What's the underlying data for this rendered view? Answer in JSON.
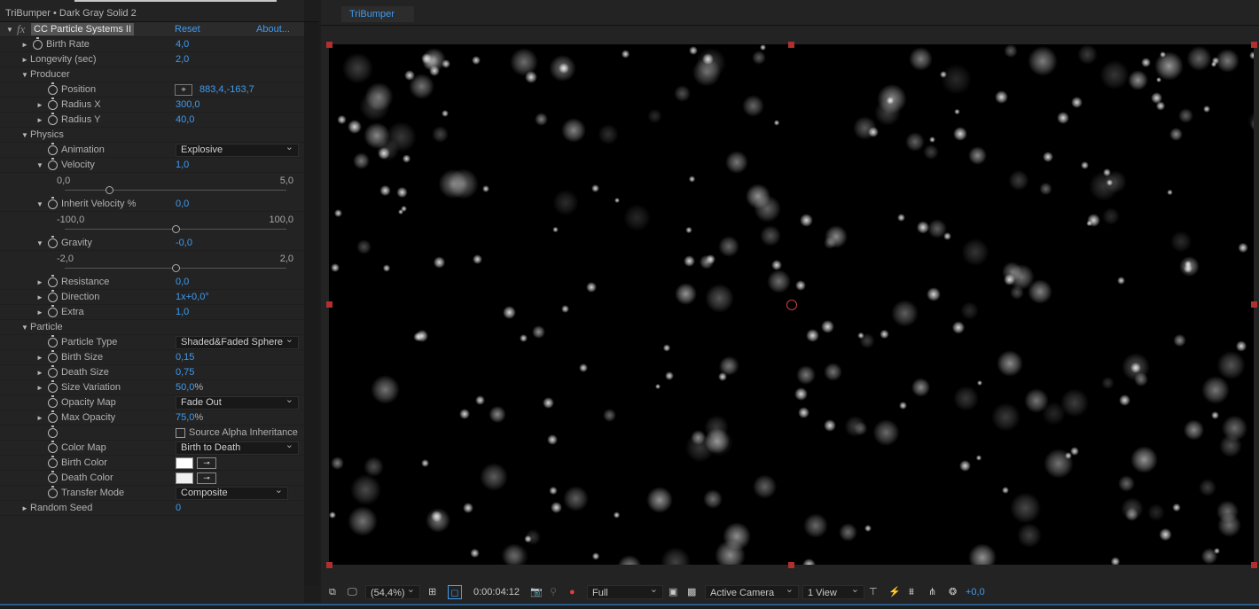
{
  "panel": {
    "title": "TriBumper • Dark Gray Solid 2",
    "effect_name": "CC Particle Systems II",
    "reset": "Reset",
    "about": "About..."
  },
  "rows": [
    {
      "kind": "prop",
      "indent": 1,
      "twirl": "closed",
      "stopwatch": true,
      "label": "Birth Rate",
      "value": "4,0"
    },
    {
      "kind": "prop",
      "indent": 1,
      "twirl": "closed",
      "stopwatch": false,
      "label": "Longevity (sec)",
      "value": "2,0"
    },
    {
      "kind": "group",
      "twirl": "open",
      "label": "Producer"
    },
    {
      "kind": "prop",
      "indent": 2,
      "twirl": "none",
      "stopwatch": true,
      "label": "Position",
      "value": "883,4,-163,7",
      "point": true
    },
    {
      "kind": "prop",
      "indent": 2,
      "twirl": "closed",
      "stopwatch": true,
      "label": "Radius X",
      "value": "300,0"
    },
    {
      "kind": "prop",
      "indent": 2,
      "twirl": "closed",
      "stopwatch": true,
      "label": "Radius Y",
      "value": "40,0"
    },
    {
      "kind": "group",
      "twirl": "open",
      "label": "Physics"
    },
    {
      "kind": "dropdown",
      "indent": 2,
      "twirl": "none",
      "stopwatch": true,
      "label": "Animation",
      "value": "Explosive"
    },
    {
      "kind": "prop",
      "indent": 2,
      "twirl": "open",
      "stopwatch": true,
      "label": "Velocity",
      "value": "1,0"
    },
    {
      "kind": "slider",
      "min": "0,0",
      "max": "5,0",
      "fraction": 0.2
    },
    {
      "kind": "prop",
      "indent": 2,
      "twirl": "open",
      "stopwatch": true,
      "label": "Inherit Velocity %",
      "value": "0,0"
    },
    {
      "kind": "slider",
      "min": "-100,0",
      "max": "100,0",
      "fraction": 0.5
    },
    {
      "kind": "prop",
      "indent": 2,
      "twirl": "open",
      "stopwatch": true,
      "label": "Gravity",
      "value": "-0,0"
    },
    {
      "kind": "slider",
      "min": "-2,0",
      "max": "2,0",
      "fraction": 0.5
    },
    {
      "kind": "prop",
      "indent": 2,
      "twirl": "closed",
      "stopwatch": true,
      "label": "Resistance",
      "value": "0,0"
    },
    {
      "kind": "prop",
      "indent": 2,
      "twirl": "closed",
      "stopwatch": true,
      "label": "Direction",
      "value": "1x+0,0°"
    },
    {
      "kind": "prop",
      "indent": 2,
      "twirl": "closed",
      "stopwatch": true,
      "label": "Extra",
      "value": "1,0"
    },
    {
      "kind": "group",
      "twirl": "open",
      "label": "Particle"
    },
    {
      "kind": "dropdown",
      "indent": 2,
      "twirl": "none",
      "stopwatch": true,
      "label": "Particle Type",
      "value": "Shaded&Faded Sphere"
    },
    {
      "kind": "prop",
      "indent": 2,
      "twirl": "closed",
      "stopwatch": true,
      "label": "Birth Size",
      "value": "0,15"
    },
    {
      "kind": "prop",
      "indent": 2,
      "twirl": "closed",
      "stopwatch": true,
      "label": "Death Size",
      "value": "0,75"
    },
    {
      "kind": "prop",
      "indent": 2,
      "twirl": "closed",
      "stopwatch": true,
      "label": "Size Variation",
      "value": "50,0",
      "unit": "%"
    },
    {
      "kind": "dropdown",
      "indent": 2,
      "twirl": "none",
      "stopwatch": true,
      "label": "Opacity Map",
      "value": "Fade Out"
    },
    {
      "kind": "prop",
      "indent": 2,
      "twirl": "closed",
      "stopwatch": true,
      "label": "Max Opacity",
      "value": "75,0",
      "unit": "%"
    },
    {
      "kind": "checkbox",
      "indent": 2,
      "twirl": "none",
      "stopwatch": true,
      "label": "",
      "value": "Source Alpha Inheritance",
      "checked": false
    },
    {
      "kind": "dropdown",
      "indent": 2,
      "twirl": "none",
      "stopwatch": true,
      "label": "Color Map",
      "value": "Birth to Death"
    },
    {
      "kind": "color",
      "indent": 2,
      "twirl": "none",
      "stopwatch": true,
      "label": "Birth Color",
      "color": "#ffffff"
    },
    {
      "kind": "color",
      "indent": 2,
      "twirl": "none",
      "stopwatch": true,
      "label": "Death Color",
      "color": "#f0f0f0"
    },
    {
      "kind": "dropdown",
      "indent": 2,
      "twirl": "none",
      "stopwatch": true,
      "label": "Transfer Mode",
      "value": "Composite",
      "narrow": true
    },
    {
      "kind": "prop",
      "indent": 1,
      "twirl": "closed",
      "stopwatch": false,
      "label": "Random Seed",
      "value": "0"
    }
  ],
  "viewer": {
    "tab": "TriBumper"
  },
  "toolbar": {
    "zoom": "(54,4%)",
    "timecode": "0:00:04:12",
    "resolution": "Full",
    "camera": "Active Camera",
    "views": "1 View",
    "exposure": "+0,0"
  },
  "colors": {
    "accent": "#3e9bf0",
    "handle": "#b03030"
  }
}
